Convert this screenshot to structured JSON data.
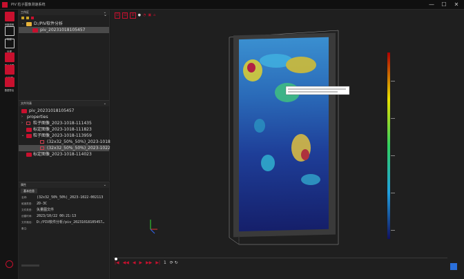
{
  "window": {
    "title": "PIV 粒子图像测速系统",
    "minimize": "—",
    "maximize": "☐",
    "close": "✕"
  },
  "toolrail": {
    "items": [
      {
        "label": "采集图像",
        "style": "red"
      },
      {
        "label": "标定",
        "style": "outline"
      },
      {
        "label": "处理",
        "style": "outline"
      },
      {
        "label": "显示结果",
        "style": "red"
      },
      {
        "label": "后处理",
        "style": "red"
      },
      {
        "label": "数据导出",
        "style": "red"
      }
    ]
  },
  "workspace": {
    "header": "工作区",
    "root": "D:/PIV软件分析",
    "child": "piv_20231018105457"
  },
  "file_panel": {
    "header": "文件列表",
    "root": "piv_20231018105457",
    "items": [
      {
        "label": "properties",
        "twisty": "›",
        "icon": "none",
        "selected": false
      },
      {
        "label": "粒子图像_2023-1018-111435",
        "twisty": "›",
        "icon": "sm",
        "selected": false
      },
      {
        "label": "标定图像_2023-1018-111823",
        "twisty": "",
        "icon": "red",
        "selected": false
      },
      {
        "label": "粒子图像_2023-1018-113959",
        "twisty": "⌄",
        "icon": "red",
        "selected": false
      },
      {
        "label": "(32x32_50%_50%)_2023-1018-...",
        "twisty": "",
        "icon": "sm",
        "selected": false
      },
      {
        "label": "(32x32_50%_50%)_2023-1022-...",
        "twisty": "",
        "icon": "sm",
        "selected": true
      },
      {
        "label": "标定图像_2023-1018-114023",
        "twisty": "",
        "icon": "red",
        "selected": false
      }
    ]
  },
  "props_panel": {
    "header": "属性",
    "tab": "基本信息",
    "rows": [
      {
        "key": "名称:",
        "value": "(32x32_50%_50%)_2023-1022-002113"
      },
      {
        "key": "维度类型:",
        "value": "2D-3C"
      },
      {
        "key": "文件类型:",
        "value": "矢量图文件"
      },
      {
        "key": "创建时间:",
        "value": "2023/10/22 00:21:13"
      },
      {
        "key": "文件路径:",
        "value": "D:/PIV软件分析/piv_20231018105457…"
      },
      {
        "key": "备注:",
        "value": ""
      }
    ]
  },
  "viewport_toolbar": {
    "items": [
      "⊡",
      "⊟",
      "⊞",
      "●",
      "◔",
      "▣",
      "⌂"
    ]
  },
  "playbar": {
    "items": [
      "|◀",
      "◀◀",
      "◀",
      "▶",
      "▶▶",
      "▶|"
    ],
    "frame": "1",
    "extra": "⟳ ↻"
  },
  "colors": {
    "accent": "#c8102e",
    "folder": "#e8b33a",
    "selection": "#4a4a4a"
  }
}
